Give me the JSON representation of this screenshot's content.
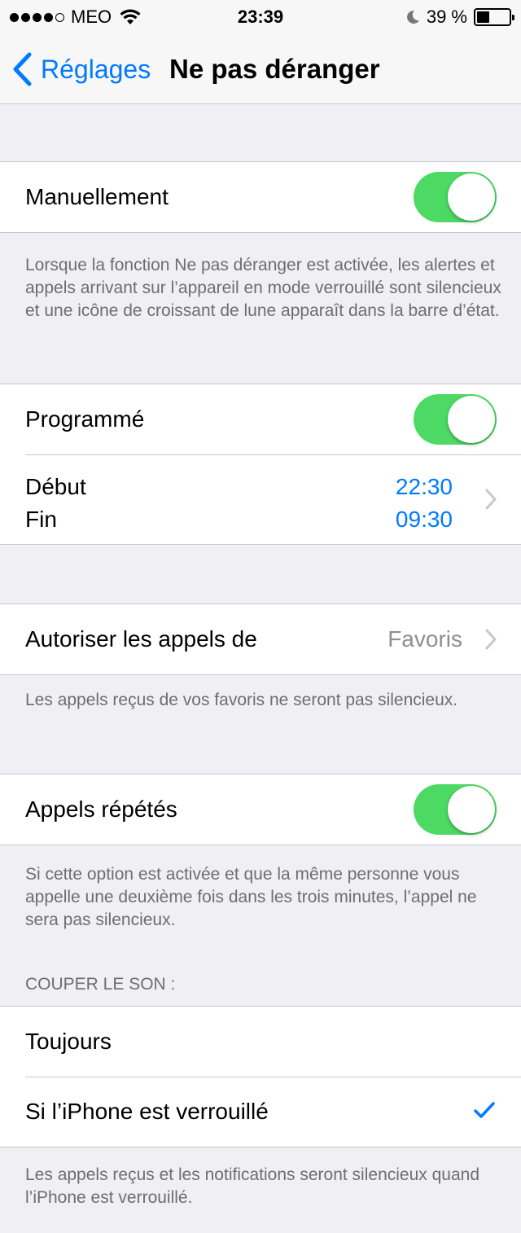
{
  "status_bar": {
    "carrier": "MEO",
    "time": "23:39",
    "battery_percent": "39 %",
    "battery_level": 0.39,
    "signal_bars": 4
  },
  "nav": {
    "back_label": "Réglages",
    "title": "Ne pas déranger"
  },
  "manual": {
    "label": "Manuellement",
    "enabled": true,
    "footer": "Lorsque la fonction Ne pas déranger est activée, les alertes et appels arrivant sur l’appareil en mode verrouillé sont silencieux et une icône de croissant de lune apparaît dans la barre d’état."
  },
  "scheduled": {
    "label": "Programmé",
    "enabled": true,
    "start_label": "Début",
    "start_value": "22:30",
    "end_label": "Fin",
    "end_value": "09:30"
  },
  "allow_calls": {
    "label": "Autoriser les appels de",
    "value": "Favoris",
    "footer": "Les appels reçus de vos favoris ne seront pas silencieux."
  },
  "repeated_calls": {
    "label": "Appels répétés",
    "enabled": true,
    "footer": "Si cette option est activée et que la même personne vous appelle une deuxième fois dans les trois minutes, l’appel ne sera pas silencieux."
  },
  "silence": {
    "header": "COUPER LE SON :",
    "options": [
      {
        "label": "Toujours",
        "selected": false
      },
      {
        "label": "Si l’iPhone est verrouillé",
        "selected": true
      }
    ],
    "footer": "Les appels reçus et les notifications seront silencieux quand l’iPhone est verrouillé."
  },
  "colors": {
    "accent": "#007aff",
    "toggle_on": "#4cd964",
    "background": "#efeff4"
  }
}
